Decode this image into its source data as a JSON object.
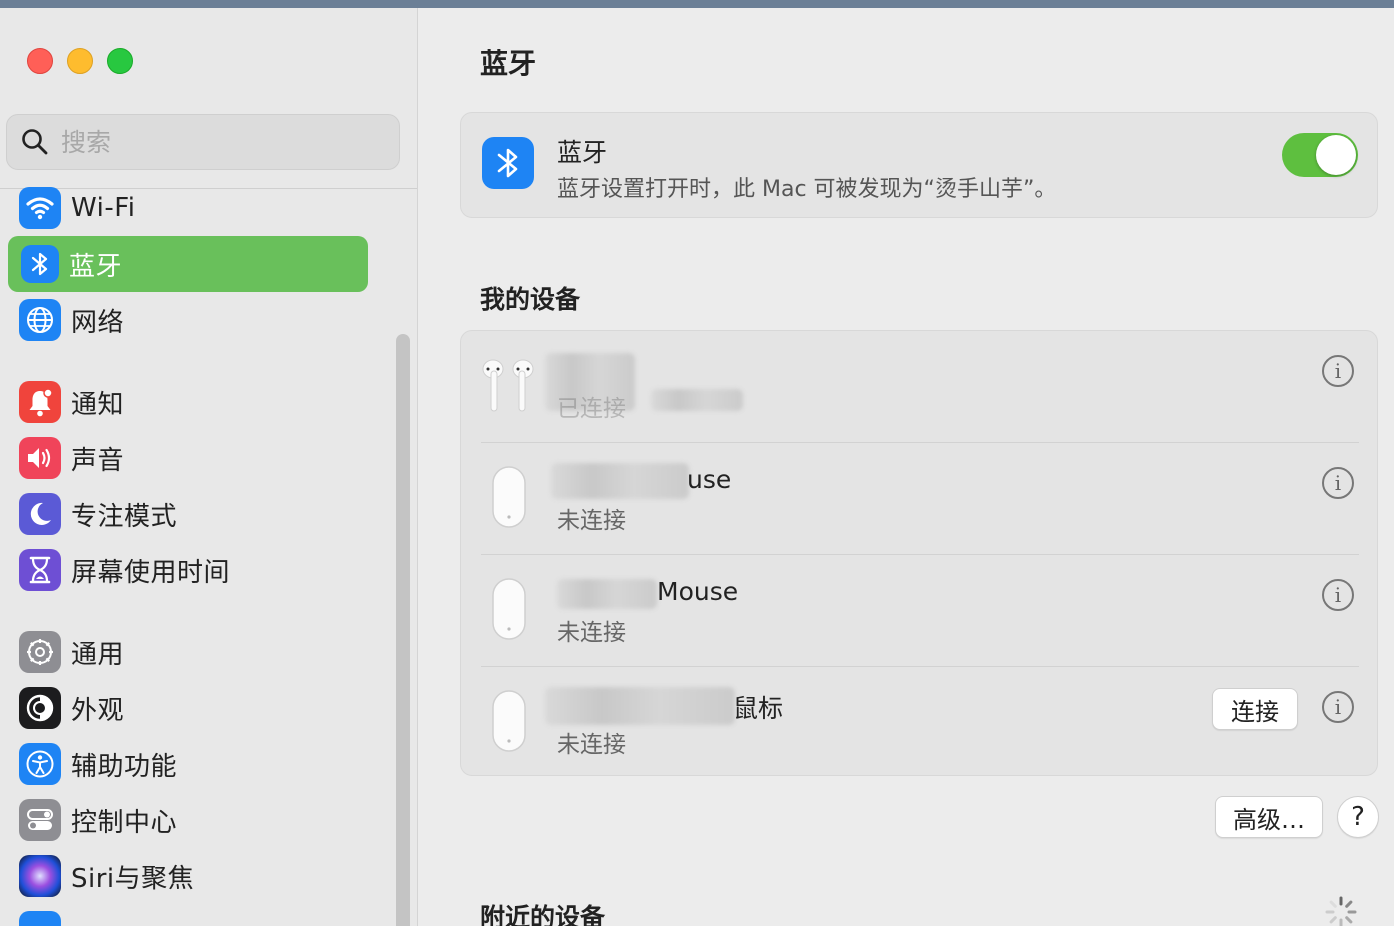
{
  "sidebar": {
    "search": {
      "placeholder": "搜索"
    },
    "items": [
      {
        "label": "Wi-Fi",
        "icon": "wifi-icon",
        "color": "#1e84f4"
      },
      {
        "label": "蓝牙",
        "icon": "bluetooth-icon",
        "color": "#1e84f4",
        "active": true
      },
      {
        "label": "网络",
        "icon": "globe-icon",
        "color": "#1e84f4"
      },
      {
        "label": "通知",
        "icon": "bell-icon",
        "color": "#f0443c"
      },
      {
        "label": "声音",
        "icon": "speaker-icon",
        "color": "#f0445a"
      },
      {
        "label": "专注模式",
        "icon": "moon-icon",
        "color": "#5b5ad6"
      },
      {
        "label": "屏幕使用时间",
        "icon": "hourglass-icon",
        "color": "#6e4fd4"
      },
      {
        "label": "通用",
        "icon": "gear-icon",
        "color": "#8e8e93"
      },
      {
        "label": "外观",
        "icon": "appearance-icon",
        "color": "#1c1c1e"
      },
      {
        "label": "辅助功能",
        "icon": "accessibility-icon",
        "color": "#1e84f4"
      },
      {
        "label": "控制中心",
        "icon": "control-center-icon",
        "color": "#8e8e93"
      },
      {
        "label": "Siri与聚焦",
        "icon": "siri-icon",
        "color": "#7a3fd6"
      }
    ],
    "active_color": "#69c05b"
  },
  "main": {
    "title": "蓝牙",
    "bluetooth": {
      "title": "蓝牙",
      "subtitle": "蓝牙设置打开时，此 Mac 可被发现为“烫手山芋”。",
      "enabled": true,
      "toggle_color": "#5ebf3f"
    },
    "my_devices_title": "我的设备",
    "devices": [
      {
        "name": "",
        "status": "已连接",
        "icon": "airpods-icon",
        "has_connect": false
      },
      {
        "name": "use",
        "status": "未连接",
        "icon": "mouse-icon",
        "has_connect": false
      },
      {
        "name": "Mouse",
        "status": "未连接",
        "icon": "mouse-icon",
        "has_connect": false
      },
      {
        "name": "鼠标",
        "status": "未连接",
        "icon": "mouse-icon",
        "has_connect": true,
        "connect_label": "连接"
      }
    ],
    "advanced_label": "高级…",
    "help_label": "?",
    "nearby_title": "附近的设备"
  }
}
